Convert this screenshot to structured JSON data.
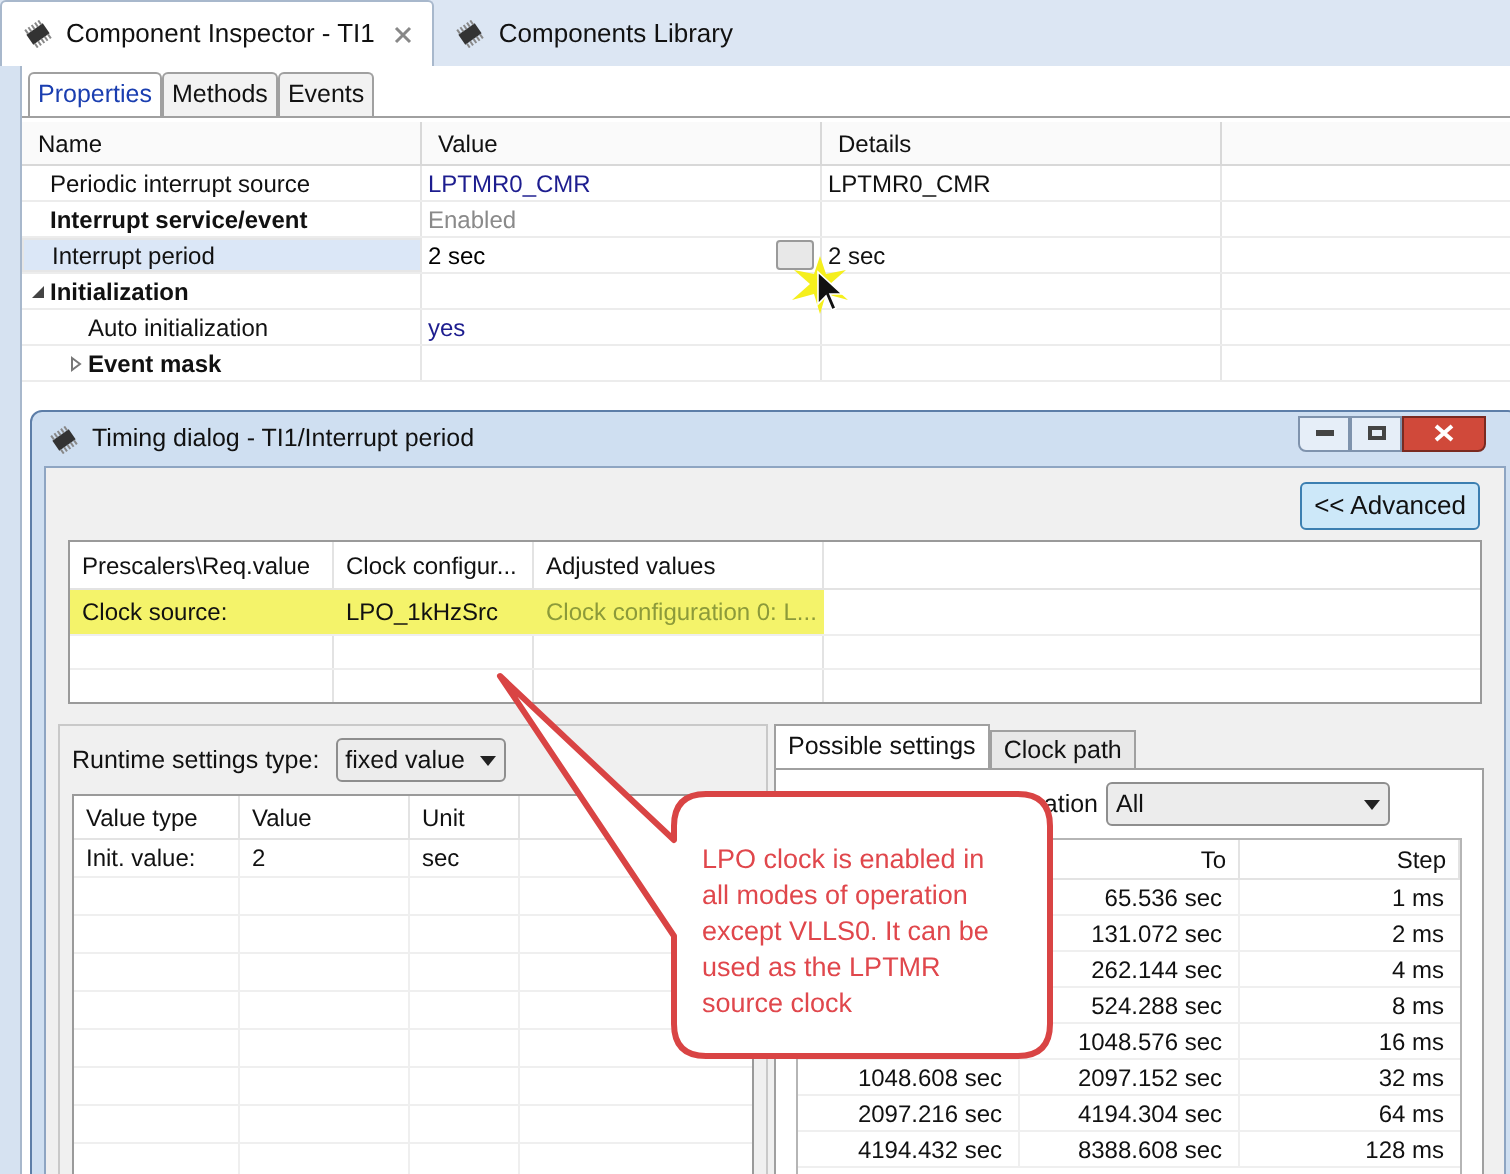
{
  "editor_tabs": [
    {
      "label": "Component Inspector - TI1",
      "selected": true,
      "closable": true
    },
    {
      "label": "Components Library",
      "selected": false,
      "closable": false
    }
  ],
  "inspector": {
    "tabs": [
      {
        "label": "Properties",
        "selected": true
      },
      {
        "label": "Methods",
        "selected": false
      },
      {
        "label": "Events",
        "selected": false
      }
    ],
    "columns": [
      "Name",
      "Value",
      "Details"
    ],
    "rows": [
      {
        "name": "Periodic interrupt source",
        "bold": false,
        "value": "LPTMR0_CMR",
        "kind": "link",
        "details": "LPTMR0_CMR",
        "selected": false
      },
      {
        "name": "Interrupt service/event",
        "bold": true,
        "value": "Enabled",
        "kind": "disabled",
        "selected": false
      },
      {
        "name": "Interrupt period",
        "bold": false,
        "value": "2 sec",
        "kind": "action",
        "details": "2 sec",
        "selected": true
      },
      {
        "name": "Initialization",
        "bold": true,
        "expanded": true,
        "selected": false,
        "children": [
          {
            "name": "Auto initialization",
            "bold": false,
            "value": "yes",
            "kind": "link",
            "selected": false
          },
          {
            "name": "Event mask",
            "bold": true,
            "expanded": false,
            "selected": false
          }
        ]
      }
    ]
  },
  "dialog": {
    "title": "Timing dialog - TI1/Interrupt period",
    "advanced_button": "<< Advanced",
    "timing_table": {
      "columns": [
        "Prescalers\\Req.value",
        "Clock configur...",
        "Adjusted values"
      ],
      "rows": [
        {
          "cells": [
            "Clock source:",
            "LPO_1kHzSrc",
            "Clock configuration 0: L..."
          ],
          "highlighted": true
        }
      ]
    },
    "runtime": {
      "label": "Runtime settings type:",
      "dropdown": "fixed value",
      "columns": [
        "Value type",
        "Value",
        "Unit"
      ],
      "rows": [
        [
          "Init. value:",
          "2",
          "sec"
        ]
      ]
    },
    "settings_tabs": [
      {
        "label": "Possible settings",
        "selected": true
      },
      {
        "label": "Clock path",
        "selected": false
      }
    ],
    "filter": {
      "label": "ation",
      "dropdown": "All"
    },
    "possible": {
      "columns": [
        "To",
        "Step"
      ],
      "rows": [
        {
          "to": "65.536 sec",
          "step": "1 ms"
        },
        {
          "to": "131.072 sec",
          "step": "2 ms"
        },
        {
          "to": "262.144 sec",
          "step": "4 ms"
        },
        {
          "to": "524.288 sec",
          "step": "8 ms"
        },
        {
          "to": "1048.576 sec",
          "step": "16 ms"
        },
        {
          "from": "1048.608 sec",
          "to": "2097.152 sec",
          "step": "32 ms"
        },
        {
          "from": "2097.216 sec",
          "to": "4194.304 sec",
          "step": "64 ms"
        },
        {
          "from": "4194.432 sec",
          "to": "8388.608 sec",
          "step": "128 ms"
        }
      ]
    }
  },
  "callout": {
    "text": "LPO clock is enabled in all modes of operation except VLLS0. It can be used as the LPTMR source clock"
  }
}
